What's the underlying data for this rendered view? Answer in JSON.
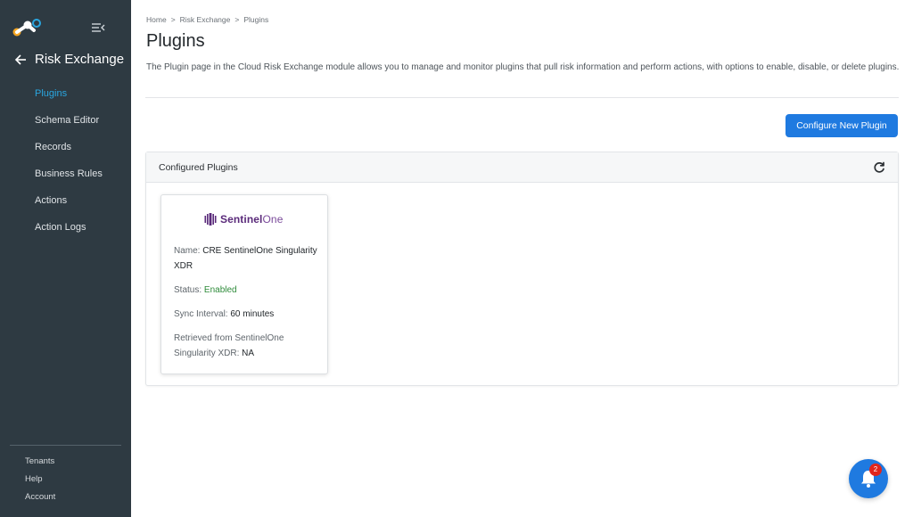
{
  "colors": {
    "sidebar_bg": "#2e3a42",
    "accent": "#1f7ae0",
    "active_nav": "#2aa6e0",
    "status_enabled": "#2e8b3a",
    "badge": "#e0261c"
  },
  "sidebar": {
    "section_title": "Risk Exchange",
    "items": [
      {
        "label": "Plugins",
        "active": true
      },
      {
        "label": "Schema Editor",
        "active": false
      },
      {
        "label": "Records",
        "active": false
      },
      {
        "label": "Business Rules",
        "active": false
      },
      {
        "label": "Actions",
        "active": false
      },
      {
        "label": "Action Logs",
        "active": false
      }
    ],
    "footer": [
      {
        "label": "Tenants"
      },
      {
        "label": "Help"
      },
      {
        "label": "Account"
      }
    ]
  },
  "breadcrumb": [
    {
      "label": "Home"
    },
    {
      "label": "Risk Exchange"
    },
    {
      "label": "Plugins"
    }
  ],
  "breadcrumb_separator": ">",
  "page": {
    "title": "Plugins",
    "description": "The Plugin page in the Cloud Risk Exchange module allows you to manage and monitor plugins that pull risk information and perform actions, with options to enable, disable, or delete plugins.",
    "configure_button": "Configure New Plugin"
  },
  "panel": {
    "title": "Configured Plugins",
    "refresh_icon": "refresh-icon",
    "plugins": [
      {
        "logo_text_bold": "Sentinel",
        "logo_text_light": "One",
        "name_label": "Name:",
        "name_value": "CRE SentinelOne Singularity XDR",
        "status_label": "Status:",
        "status_value": "Enabled",
        "sync_label": "Sync Interval:",
        "sync_value": "60 minutes",
        "retrieved_label": "Retrieved from SentinelOne Singularity XDR:",
        "retrieved_value": "NA"
      }
    ]
  },
  "notifications": {
    "count": "2",
    "icon": "bell-icon"
  }
}
